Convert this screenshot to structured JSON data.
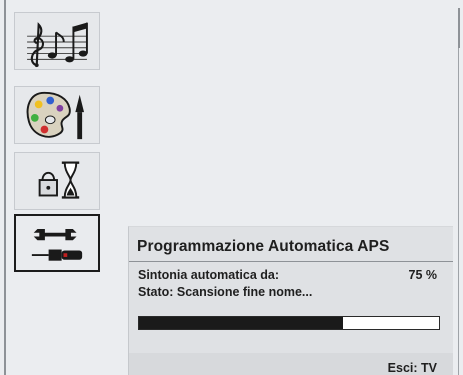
{
  "menu": {
    "items": [
      {
        "icon": "music-notes-icon",
        "selected": false
      },
      {
        "icon": "paint-palette-icon",
        "selected": false
      },
      {
        "icon": "timer-hourglass-icon",
        "selected": false
      },
      {
        "icon": "wrench-screwdriver-icon",
        "selected": true
      }
    ]
  },
  "dialog": {
    "title": "Programmazione Automatica APS",
    "search_label": "Sintonia automatica da:",
    "percent_text": "75 %",
    "status_text": "Stato: Scansione fine nome...",
    "progress_fraction": 0.68,
    "exit_hint": "Esci: TV"
  },
  "colors": {
    "background": "#ebedf0",
    "panel": "#dfe1e4",
    "progress_fill": "#1a1a1a",
    "progress_track": "#ffffff"
  }
}
